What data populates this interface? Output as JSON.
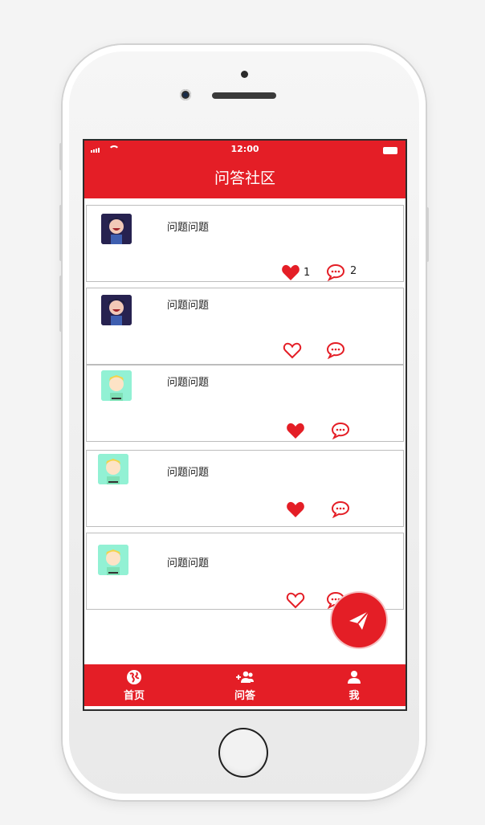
{
  "status_bar": {
    "time": "12:00"
  },
  "header": {
    "title": "问答社区"
  },
  "posts": [
    {
      "text": "问题问题",
      "liked": true,
      "like_count": "1",
      "comment_count": "2",
      "avatar": "dark-avatar"
    },
    {
      "text": "问题问题",
      "liked": false,
      "like_count": "",
      "comment_count": "",
      "avatar": "dark-avatar"
    },
    {
      "text": "问题问题",
      "liked": true,
      "like_count": "",
      "comment_count": "",
      "avatar": "mint-avatar"
    },
    {
      "text": "问题问题",
      "liked": true,
      "like_count": "",
      "comment_count": "",
      "avatar": "mint-avatar"
    },
    {
      "text": "问题问题",
      "liked": false,
      "like_count": "",
      "comment_count": "",
      "avatar": "mint-avatar"
    }
  ],
  "fab": {
    "icon": "send-icon"
  },
  "tabbar": {
    "items": [
      {
        "label": "首页",
        "icon": "globe-icon"
      },
      {
        "label": "问答",
        "icon": "add-user-icon"
      },
      {
        "label": "我",
        "icon": "user-icon"
      }
    ]
  },
  "colors": {
    "accent": "#e41e26"
  }
}
